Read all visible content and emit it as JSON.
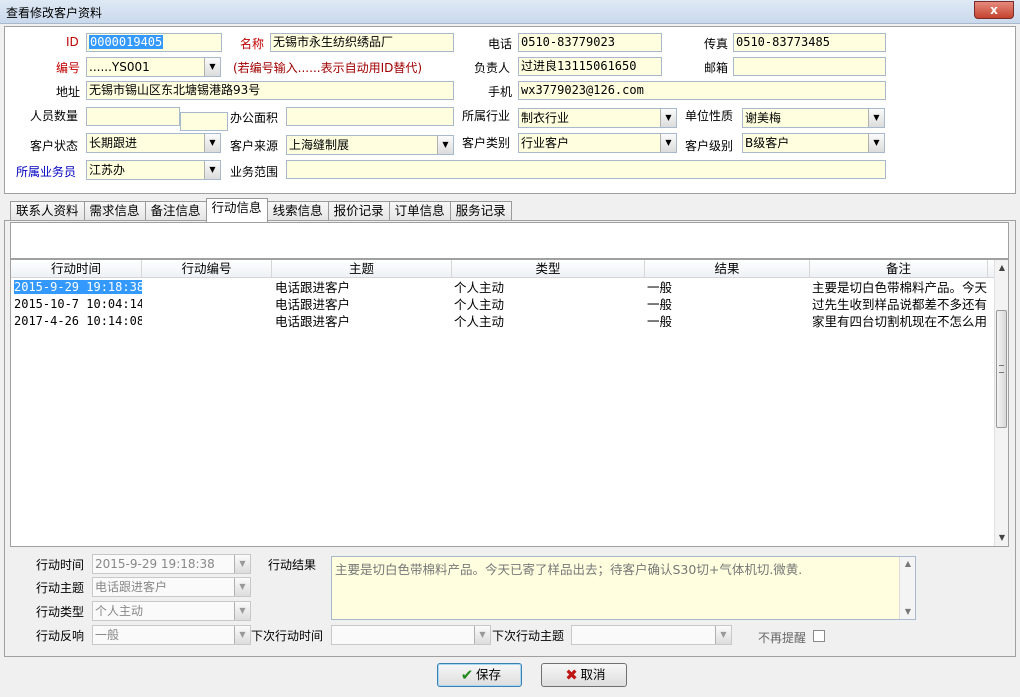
{
  "window": {
    "title": "查看修改客户资料",
    "close_label": "x"
  },
  "form": {
    "id_label": "ID",
    "id_value": "0000019405",
    "name_label": "名称",
    "name_value": "无锡市永生纺织绣品厂",
    "phone_label": "电话",
    "phone_value": "0510-83779023",
    "fax_label": "传真",
    "fax_value": "0510-83773485",
    "code_label": "编号",
    "code_value": "......YS001",
    "code_hint": "(若编号输入......表示自动用ID替代)",
    "owner_label": "负责人",
    "owner_value": "过进良13115061650",
    "mail_label": "邮箱",
    "mail_value": "",
    "address_label": "地址",
    "address_value": "无锡市锡山区东北塘锡港路93号",
    "mobile_label": "手机",
    "mobile_value": "wx3779023@126.com",
    "staff_label": "人员数量",
    "staff_value": "",
    "office_label": "办公面积",
    "office_value": "",
    "industry_label": "所属行业",
    "industry_value": "制衣行业",
    "unit_label": "单位性质",
    "unit_value": "谢美梅",
    "status_label": "客户状态",
    "status_value": "长期跟进",
    "source_label": "客户来源",
    "source_value": "上海缝制展",
    "category_label": "客户类别",
    "category_value": "行业客户",
    "level_label": "客户级别",
    "level_value": "B级客户",
    "salesman_label": "所属业务员",
    "salesman_value": "江苏办",
    "scope_label": "业务范围",
    "scope_value": ""
  },
  "tabs": [
    {
      "label": "联系人资料"
    },
    {
      "label": "需求信息"
    },
    {
      "label": "备注信息"
    },
    {
      "label": "行动信息"
    },
    {
      "label": "线索信息"
    },
    {
      "label": "报价记录"
    },
    {
      "label": "订单信息"
    },
    {
      "label": "服务记录"
    }
  ],
  "table": {
    "headers": [
      "行动时间",
      "行动编号",
      "主题",
      "类型",
      "结果",
      "备注"
    ],
    "rows": [
      [
        "2015-9-29 19:18:38",
        "",
        "电话跟进客户",
        "个人主动",
        "一般",
        "主要是切白色带棉料产品。今天"
      ],
      [
        "2015-10-7 10:04:14",
        "",
        "电话跟进客户",
        "个人主动",
        "一般",
        "过先生收到样品说都差不多还有"
      ],
      [
        "2017-4-26 10:14:08",
        "",
        "电话跟进客户",
        "个人主动",
        "一般",
        "家里有四台切割机现在不怎么用"
      ]
    ]
  },
  "detail": {
    "time_label": "行动时间",
    "time_value": "2015-9-29 19:18:38",
    "subject_label": "行动主题",
    "subject_value": "电话跟进客户",
    "type_label": "行动类型",
    "type_value": "个人主动",
    "feedback_label": "行动反响",
    "feedback_value": "一般",
    "result_label": "行动结果",
    "result_value": "主要是切白色带棉料产品。今天已寄了样品出去；待客户确认S30切+气体机切.微黄.",
    "next_time_label": "下次行动时间",
    "next_time_value": "",
    "next_subject_label": "下次行动主题",
    "next_subject_value": "",
    "no_remind_label": "不再提醒"
  },
  "buttons": {
    "save": "保存",
    "cancel": "取消"
  }
}
